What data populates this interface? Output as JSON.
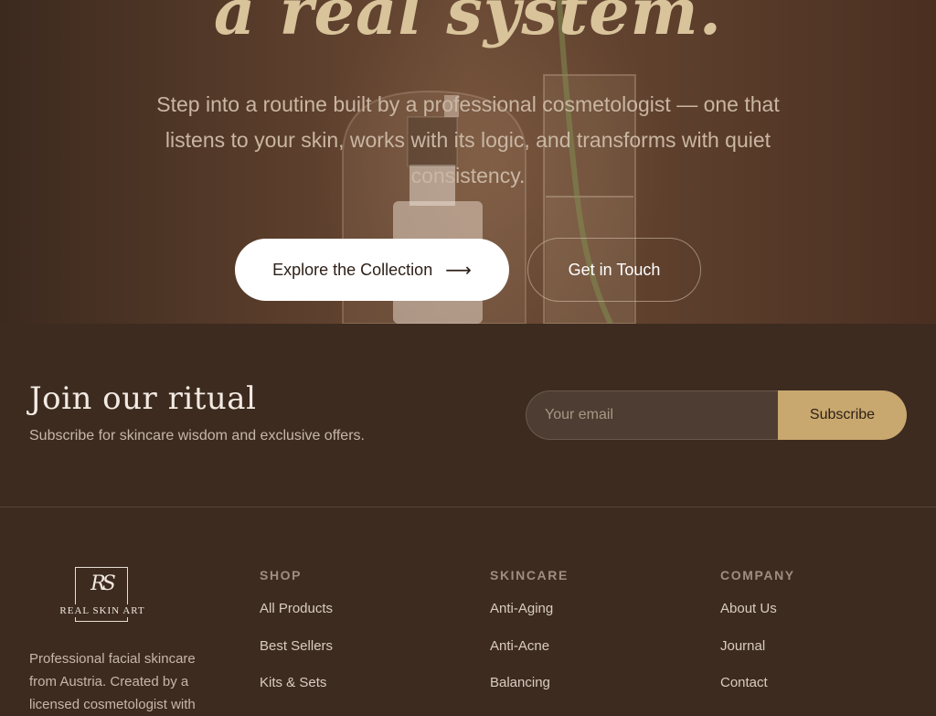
{
  "hero": {
    "headline": "a real system.",
    "subtitle": "Step into a routine built by a professional cosmetologist — one that listens to your skin, works with its logic, and transforms with quiet consistency.",
    "primary_button": "Explore the Collection",
    "primary_button_icon": "arrow-right-icon",
    "secondary_button": "Get in Touch"
  },
  "newsletter": {
    "title": "Join our ritual",
    "subtitle": "Subscribe for skincare wisdom and exclusive offers.",
    "email_placeholder": "Your email",
    "subscribe_label": "Subscribe"
  },
  "footer": {
    "logo_monogram": "RS",
    "logo_text": "REAL SKIN ART",
    "description": "Professional facial skincare from Austria. Created by a licensed cosmetologist with",
    "columns": [
      {
        "title": "SHOP",
        "links": [
          "All Products",
          "Best Sellers",
          "Kits & Sets"
        ]
      },
      {
        "title": "SKINCARE",
        "links": [
          "Anti-Aging",
          "Anti-Acne",
          "Balancing"
        ]
      },
      {
        "title": "COMPANY",
        "links": [
          "About Us",
          "Journal",
          "Contact"
        ]
      }
    ]
  },
  "colors": {
    "background": "#3d2b20",
    "accent_gold": "#c8a86e",
    "headline_gold": "#d8c39b"
  }
}
